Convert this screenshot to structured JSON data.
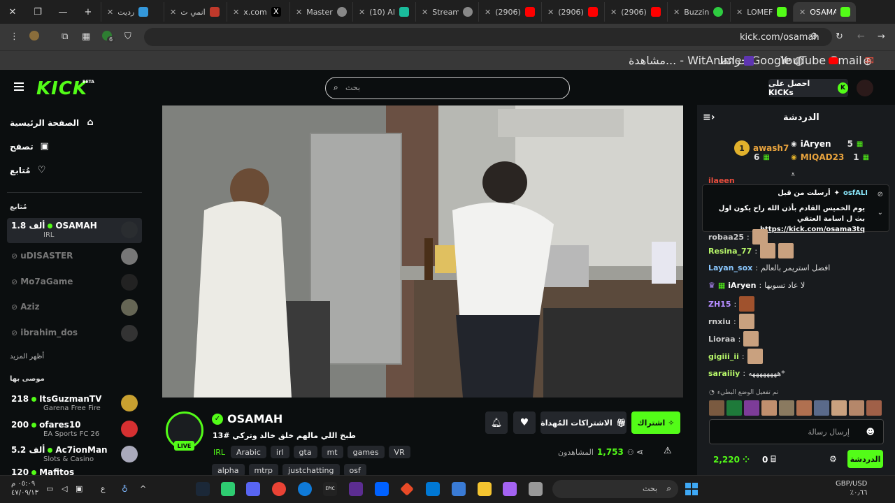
{
  "browser": {
    "tabs": [
      {
        "title": "OSAMA",
        "active": true,
        "color": "#53fc18"
      },
      {
        "title": "LOMEF",
        "color": "#53fc18"
      },
      {
        "title": "Buzzin",
        "color": "#2ecc40"
      },
      {
        "title": "(2906)",
        "color": "#ff0000"
      },
      {
        "title": "(2906)",
        "color": "#ff0000"
      },
      {
        "title": "(2906)",
        "color": "#ff0000"
      },
      {
        "title": "Stream",
        "color": "#888888"
      },
      {
        "title": "(10) Al",
        "color": "#888888"
      },
      {
        "title": "Master",
        "color": "#888888"
      },
      {
        "title": "x.com",
        "color": "#ffffff"
      },
      {
        "title": "انمي ت",
        "color": "#c0392b"
      },
      {
        "title": "رديت",
        "color": "#3498db"
      }
    ],
    "url": "kick.com/osamah",
    "extension_badge": "6",
    "bookmarks": [
      {
        "label": "Gmail",
        "icon": "gmail-icon"
      },
      {
        "label": "YouTube",
        "icon": "youtube-icon"
      },
      {
        "label": "خرائط Google",
        "icon": "maps-icon"
      },
      {
        "label": "مشاهدة... - WitAnime",
        "icon": "witanime-icon"
      }
    ]
  },
  "kick": {
    "logo": "KICK",
    "beta": "BETA",
    "search_placeholder": "بحث",
    "get_kicks": "احصل على KICKs",
    "kicks_icon": "K"
  },
  "sidebar": {
    "nav": [
      {
        "label": "الصفحة الرئيسية",
        "icon": "⌂"
      },
      {
        "label": "تصفح",
        "icon": "▣"
      },
      {
        "label": "مُتابع",
        "icon": "♡"
      }
    ],
    "following_header": "مُتابع",
    "following": [
      {
        "name": "OSAMAH",
        "viewers": "1.8 ألف",
        "category": "IRL",
        "live": true
      },
      {
        "name": "uDISASTER",
        "live": false
      },
      {
        "name": "Mo7aGame",
        "live": false
      },
      {
        "name": "Aziz",
        "live": false
      },
      {
        "name": "ibrahim_dos",
        "live": false
      }
    ],
    "show_more": "أظهر المزيد",
    "recommended_header": "موصى بها",
    "recommended": [
      {
        "name": "ItsGuzmanTV",
        "viewers": "218",
        "category": "Garena Free Fire"
      },
      {
        "name": "ofares10",
        "viewers": "200",
        "category": "EA Sports FC 26"
      },
      {
        "name": "Ac7ionMan",
        "viewers": "5.2 ألف",
        "category": "Slots & Casino"
      },
      {
        "name": "Mafitos",
        "viewers": "120",
        "category": ""
      }
    ]
  },
  "stream": {
    "name": "OSAMAH",
    "title": "طبخ اللي مالهم خلق خالد وتركي #13",
    "live_badge": "LIVE",
    "categories": [
      "IRL",
      "Arabic",
      "irl",
      "gta",
      "mt",
      "games",
      "VR",
      "alpha",
      "mtrp",
      "justchatting",
      "osf"
    ],
    "subscribe_label": "اشتراك",
    "gift_label": "الاشتراكات المُهداة",
    "viewers_label": "المشاهدون",
    "viewers_count": "1,753"
  },
  "chat": {
    "title": "الدردشة",
    "leaderboard": [
      {
        "rank": "1",
        "name": "awash7",
        "count": "6"
      },
      {
        "rank": "5",
        "name": "iAryen"
      },
      {
        "rank": "1",
        "name": "MIQAD23"
      }
    ],
    "pinned": {
      "header": "أرسلت من قبل",
      "user": "osfALI",
      "text": "يوم الخميس القادم بأذن الله راح يكون اول بث ل اسامة العتقي",
      "link": "https://kick.com/osama3tq"
    },
    "partial_user": "ilaeen",
    "messages": [
      {
        "user": "robaa25",
        "text": "",
        "color": "#cccccc"
      },
      {
        "user": "Resina_77",
        "text": "",
        "color": "#b8f86a"
      },
      {
        "user": "Layan_sox",
        "text": "افضل استريمر بالعالم",
        "color": "#8bc8ff"
      },
      {
        "user": "iAryen",
        "text": "لا عاد تسويها",
        "color": "#ffffff"
      },
      {
        "user": "ZH15",
        "text": "",
        "color": "#b48cff"
      },
      {
        "user": "rnxiu",
        "text": "",
        "color": "#cccccc"
      },
      {
        "user": "Lioraa",
        "text": "",
        "color": "#cccccc"
      },
      {
        "user": "gigiii_ii",
        "text": "",
        "color": "#b8f86a"
      },
      {
        "user": "saraiiiy",
        "text": "ههههههههه*",
        "color": "#b8f86a"
      }
    ],
    "slow_mode": "تم تفعيل الوضع البطيء",
    "input_placeholder": "إرسال رسالة",
    "points": "2,220",
    "zero": "0",
    "send_label": "الدردشة"
  },
  "taskbar": {
    "search": "بحث",
    "time": "٠٥:٠٩ م",
    "date": "٤٧/٠٩/١٣",
    "currency": "GBP/USD",
    "currency_value": "٪٠٫٦٦",
    "lang": "ع"
  },
  "colors": {
    "accent": "#53fc18",
    "panel": "#181b1e",
    "bg": "#0b0e0f"
  }
}
